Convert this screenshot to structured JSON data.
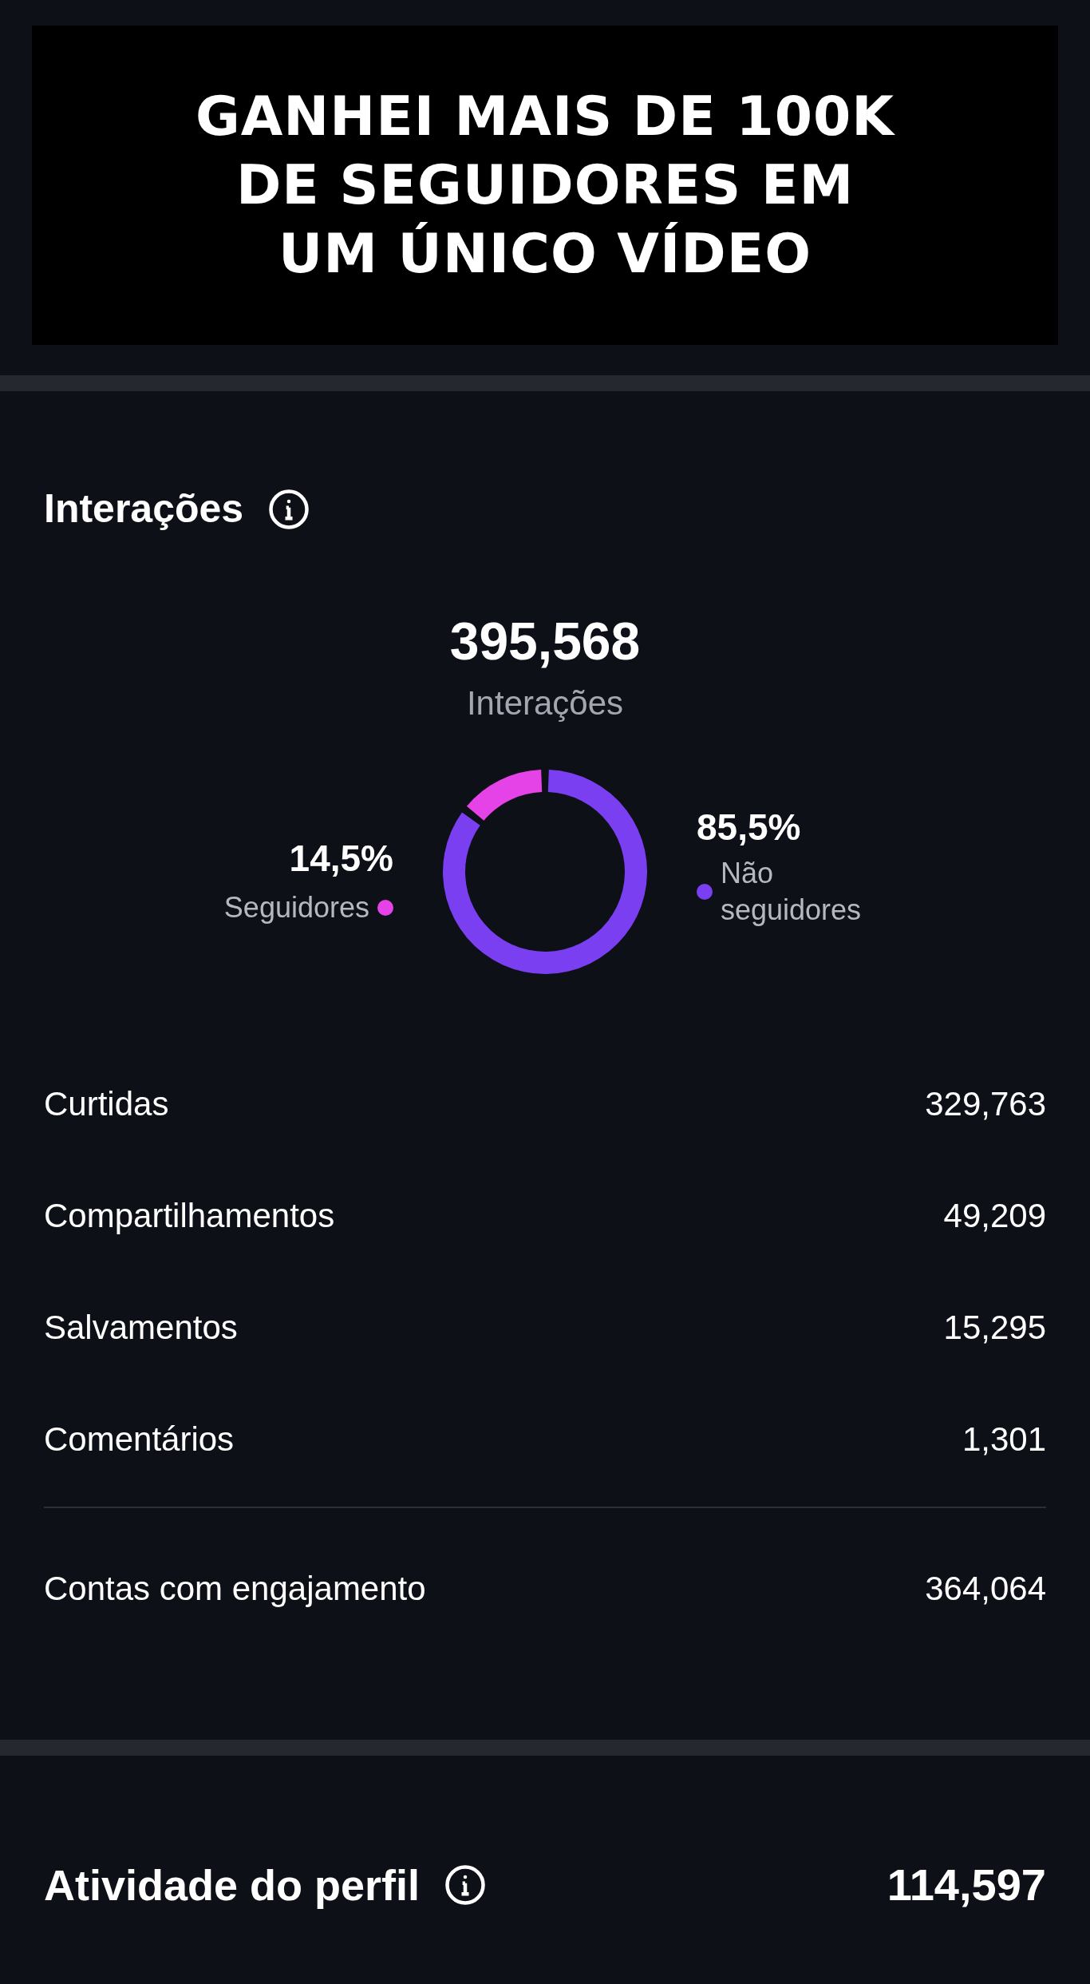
{
  "banner": {
    "lines": [
      "GANHEI MAIS DE 100K",
      "DE SEGUIDORES EM",
      "UM ÚNICO VÍDEO"
    ]
  },
  "interactions": {
    "title": "Interações",
    "total": "395,568",
    "total_label": "Interações",
    "legend": [
      {
        "value": "14,5%",
        "color": "#e543e8"
      },
      {
        "value": "85,5%",
        "color": "#7b3ff2"
      }
    ],
    "chart_data": {
      "type": "donut",
      "categories": [
        "Seguidores",
        "Não seguidores"
      ],
      "values": [
        14.5,
        85.5
      ]
    },
    "rows": [
      {
        "label": "Curtidas",
        "value": "329,763"
      },
      {
        "label": "Compartilhamentos",
        "value": "49,209"
      },
      {
        "label": "Salvamentos",
        "value": "15,295"
      },
      {
        "label": "Comentários",
        "value": "1,301"
      }
    ],
    "summary": {
      "label": "Contas com engajamento",
      "value": "364,064"
    }
  },
  "profile_activity": {
    "title": "Atividade do perfil",
    "value": "114,597"
  }
}
